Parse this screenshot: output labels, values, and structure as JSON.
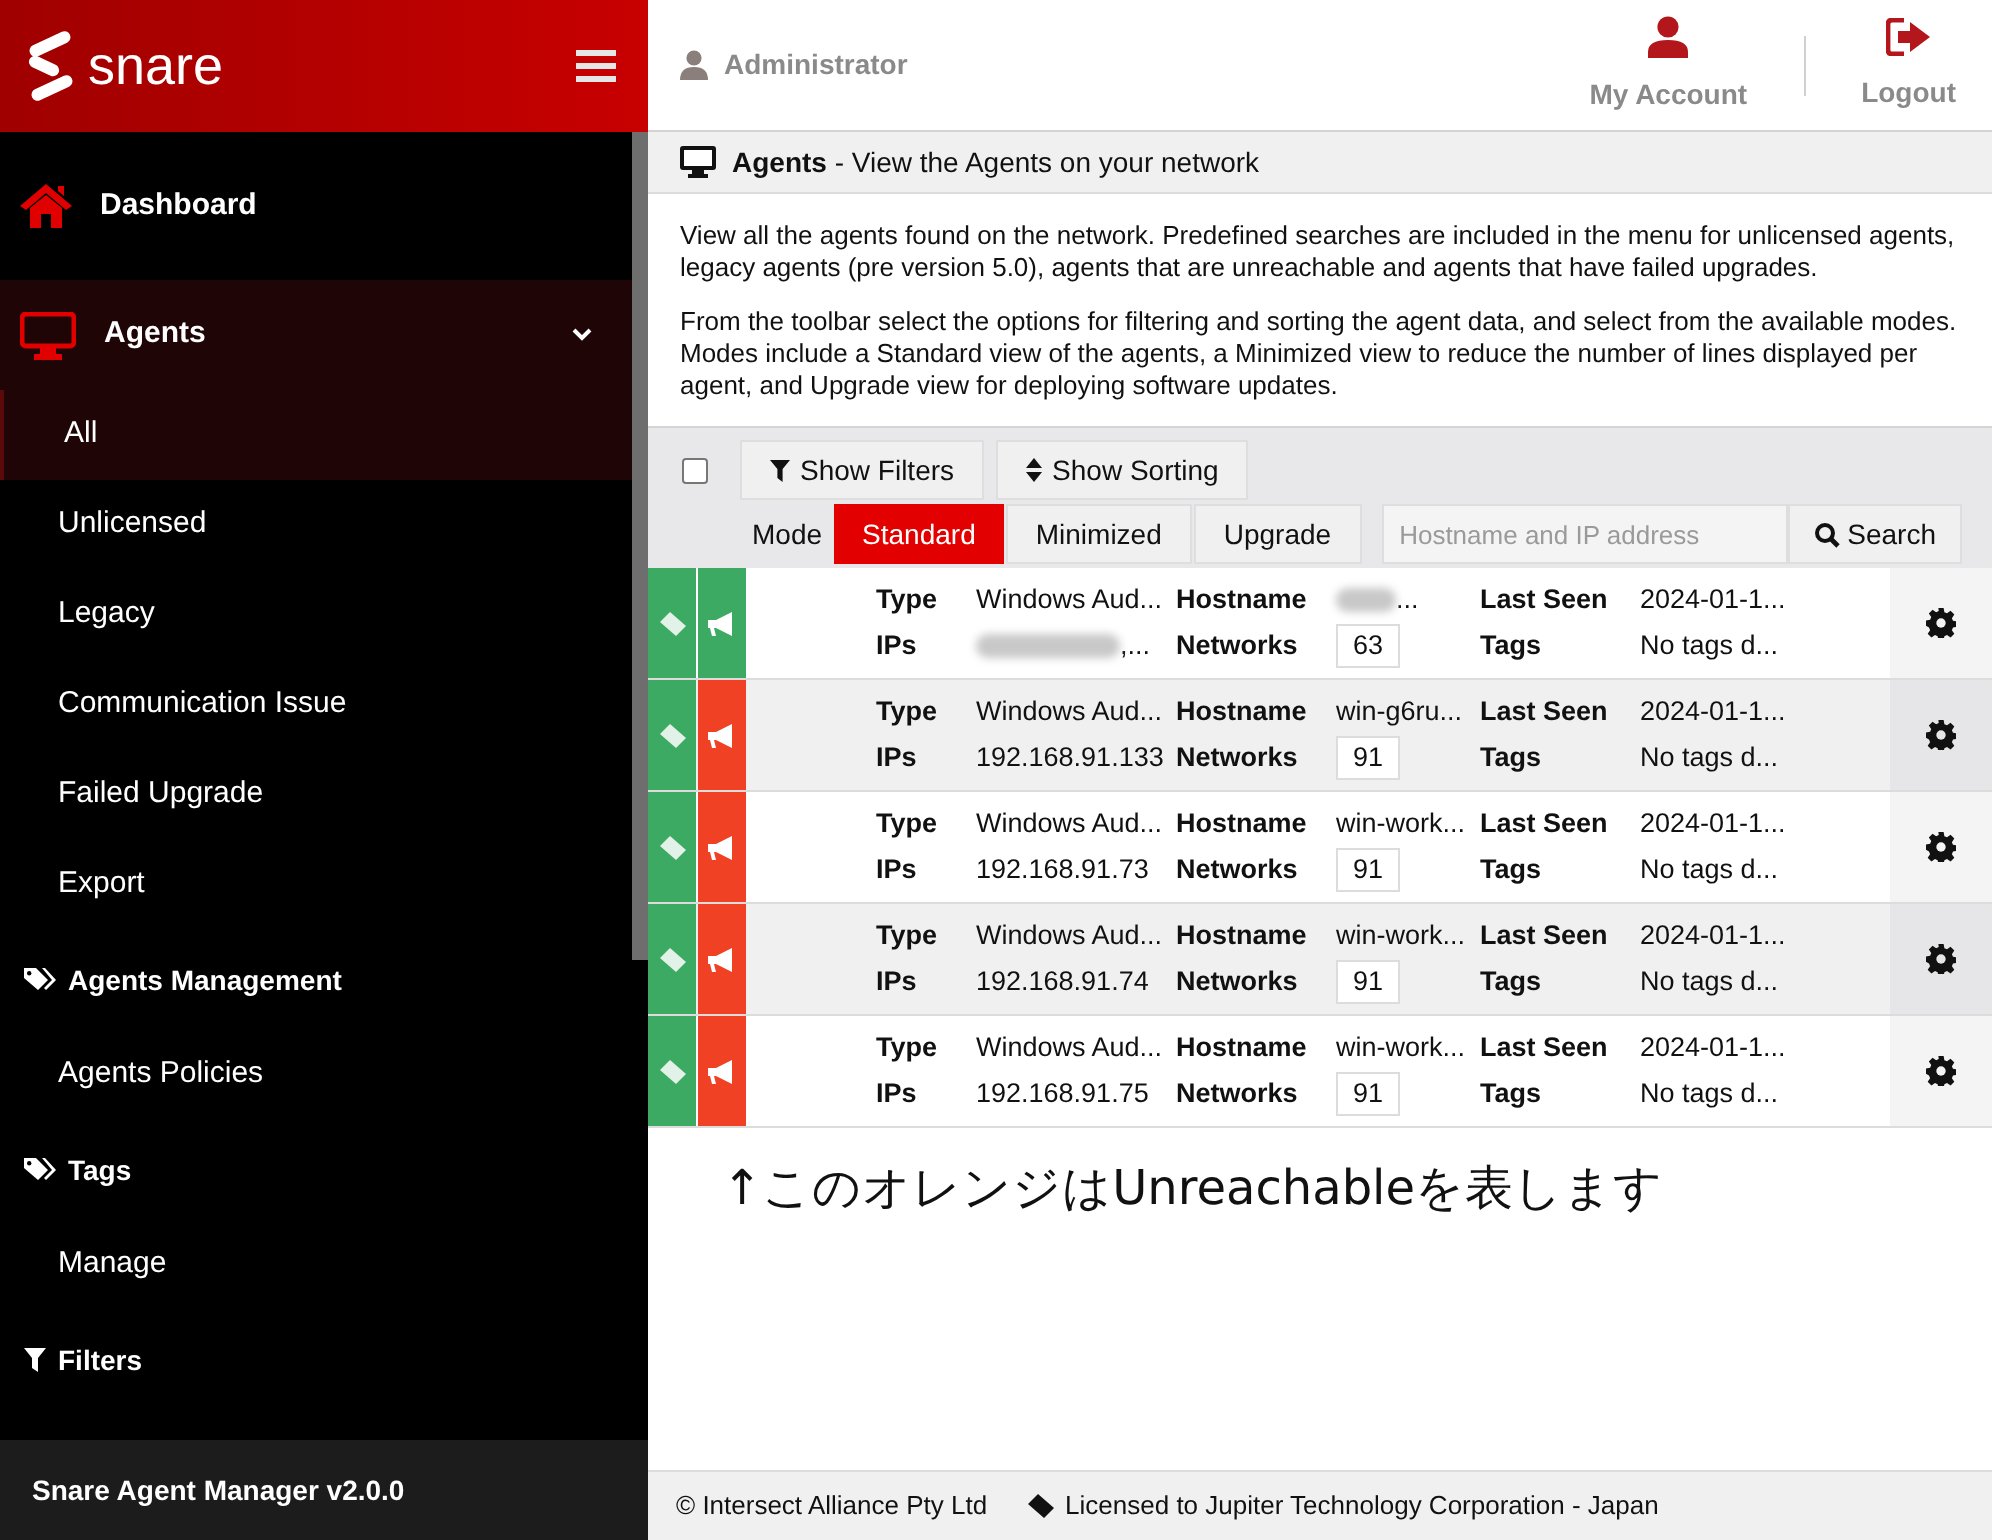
{
  "brand": {
    "name": "snare"
  },
  "sidebar": {
    "items": [
      {
        "kind": "main",
        "label": "Dashboard",
        "expanded": false,
        "selected": false
      },
      {
        "kind": "main",
        "label": "Agents",
        "expanded": true,
        "selected": false
      },
      {
        "kind": "sub",
        "label": "All",
        "selected": true
      },
      {
        "kind": "sub",
        "label": "Unlicensed",
        "selected": false
      },
      {
        "kind": "sub",
        "label": "Legacy",
        "selected": false
      },
      {
        "kind": "sub",
        "label": "Communication Issue",
        "selected": false
      },
      {
        "kind": "sub",
        "label": "Failed Upgrade",
        "selected": false
      },
      {
        "kind": "sub",
        "label": "Export",
        "selected": false
      },
      {
        "kind": "section",
        "label": "Agents Management"
      },
      {
        "kind": "sub",
        "label": "Agents Policies",
        "selected": false
      },
      {
        "kind": "section",
        "label": "Tags"
      },
      {
        "kind": "sub",
        "label": "Manage",
        "selected": false
      },
      {
        "kind": "section",
        "label": "Filters"
      }
    ],
    "footer": "Snare Agent Manager v2.0.0"
  },
  "header": {
    "user": "Administrator",
    "actions": [
      {
        "label": "My Account"
      },
      {
        "label": "Logout"
      }
    ]
  },
  "page_title": {
    "title": "Agents",
    "subtitle": " - View the Agents on your network"
  },
  "description": [
    "View all the agents found on the network. Predefined searches are included in the menu for unlicensed agents, legacy agents (pre version 5.0), agents that are unreachable and agents that have failed upgrades.",
    "From the toolbar select the options for filtering and sorting the agent data, and select from the available modes. Modes include a Standard view of the agents, a Minimized view to reduce the number of lines displayed per agent, and Upgrade view for deploying software updates."
  ],
  "toolbar": {
    "select_all": false,
    "buttons": [
      {
        "label": "Show Filters"
      },
      {
        "label": "Show Sorting"
      }
    ],
    "mode_label": "Mode",
    "modes": [
      {
        "label": "Standard",
        "selected": true
      },
      {
        "label": "Minimized",
        "selected": false
      },
      {
        "label": "Upgrade",
        "selected": false
      }
    ],
    "search": {
      "placeholder": "Hostname and IP address",
      "button": "Search"
    }
  },
  "agents": [
    {
      "indicators": [
        {
          "color": "#3daa63"
        },
        {
          "color": "#3daa63"
        }
      ],
      "fields": [
        {
          "label": "Type",
          "value": "Windows Aud..."
        },
        {
          "label": "Hostname",
          "value": "...",
          "redacted": true
        },
        {
          "label": "Last Seen",
          "value": "2024-01-1..."
        },
        {
          "label": "IPs",
          "value": ",...",
          "redacted": true
        },
        {
          "label": "Networks",
          "value": "63",
          "kind": "count"
        },
        {
          "label": "Tags",
          "value": "No tags d..."
        }
      ]
    },
    {
      "indicators": [
        {
          "color": "#3daa63"
        },
        {
          "color": "#f04124"
        }
      ],
      "fields": [
        {
          "label": "Type",
          "value": "Windows Aud..."
        },
        {
          "label": "Hostname",
          "value": "win-g6ru..."
        },
        {
          "label": "Last Seen",
          "value": "2024-01-1..."
        },
        {
          "label": "IPs",
          "value": "192.168.91.133"
        },
        {
          "label": "Networks",
          "value": "91",
          "kind": "count"
        },
        {
          "label": "Tags",
          "value": "No tags d..."
        }
      ]
    },
    {
      "indicators": [
        {
          "color": "#3daa63"
        },
        {
          "color": "#f04124"
        }
      ],
      "fields": [
        {
          "label": "Type",
          "value": "Windows Aud..."
        },
        {
          "label": "Hostname",
          "value": "win-work..."
        },
        {
          "label": "Last Seen",
          "value": "2024-01-1..."
        },
        {
          "label": "IPs",
          "value": "192.168.91.73"
        },
        {
          "label": "Networks",
          "value": "91",
          "kind": "count"
        },
        {
          "label": "Tags",
          "value": "No tags d..."
        }
      ]
    },
    {
      "indicators": [
        {
          "color": "#3daa63"
        },
        {
          "color": "#f04124"
        }
      ],
      "fields": [
        {
          "label": "Type",
          "value": "Windows Aud..."
        },
        {
          "label": "Hostname",
          "value": "win-work..."
        },
        {
          "label": "Last Seen",
          "value": "2024-01-1..."
        },
        {
          "label": "IPs",
          "value": "192.168.91.74"
        },
        {
          "label": "Networks",
          "value": "91",
          "kind": "count"
        },
        {
          "label": "Tags",
          "value": "No tags d..."
        }
      ]
    },
    {
      "indicators": [
        {
          "color": "#3daa63"
        },
        {
          "color": "#f04124"
        }
      ],
      "fields": [
        {
          "label": "Type",
          "value": "Windows Aud..."
        },
        {
          "label": "Hostname",
          "value": "win-work..."
        },
        {
          "label": "Last Seen",
          "value": "2024-01-1..."
        },
        {
          "label": "IPs",
          "value": "192.168.91.75"
        },
        {
          "label": "Networks",
          "value": "91",
          "kind": "count"
        },
        {
          "label": "Tags",
          "value": "No tags d..."
        }
      ]
    }
  ],
  "annotation": "↑このオレンジはUnreachableを表します",
  "footer": {
    "copyright": "© Intersect Alliance Pty Ltd",
    "license": "Licensed to Jupiter Technology Corporation - Japan"
  }
}
